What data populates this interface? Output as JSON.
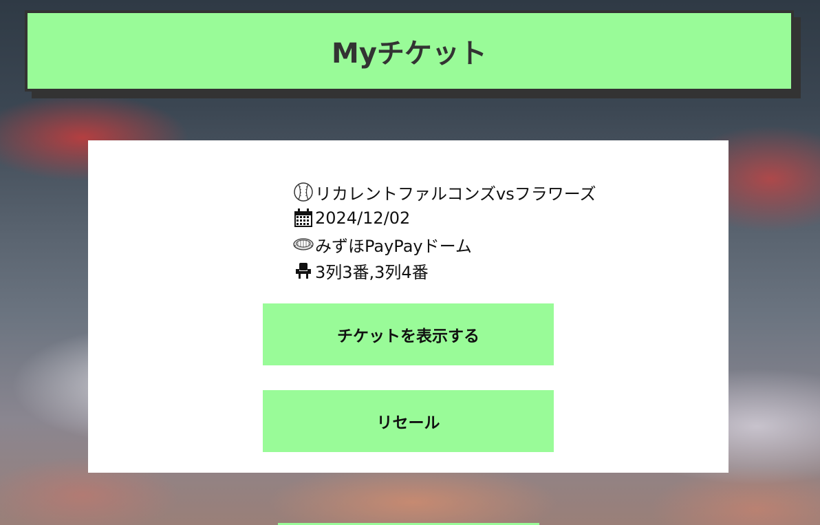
{
  "header": {
    "title": "Myチケット"
  },
  "ticket": {
    "match": "リカレントファルコンズvsフラワーズ",
    "date": "2024/12/02",
    "venue": "みずほPayPayドーム",
    "seats": "3列3番,3列4番",
    "icons": [
      "baseball-icon",
      "calendar-icon",
      "stadium-icon",
      "seat-icon"
    ]
  },
  "actions": {
    "view_label": "チケットを表示する",
    "resale_label": "リセール"
  },
  "colors": {
    "accent": "#99fb98",
    "header_border": "#333333",
    "card_bg": "#ffffff"
  }
}
